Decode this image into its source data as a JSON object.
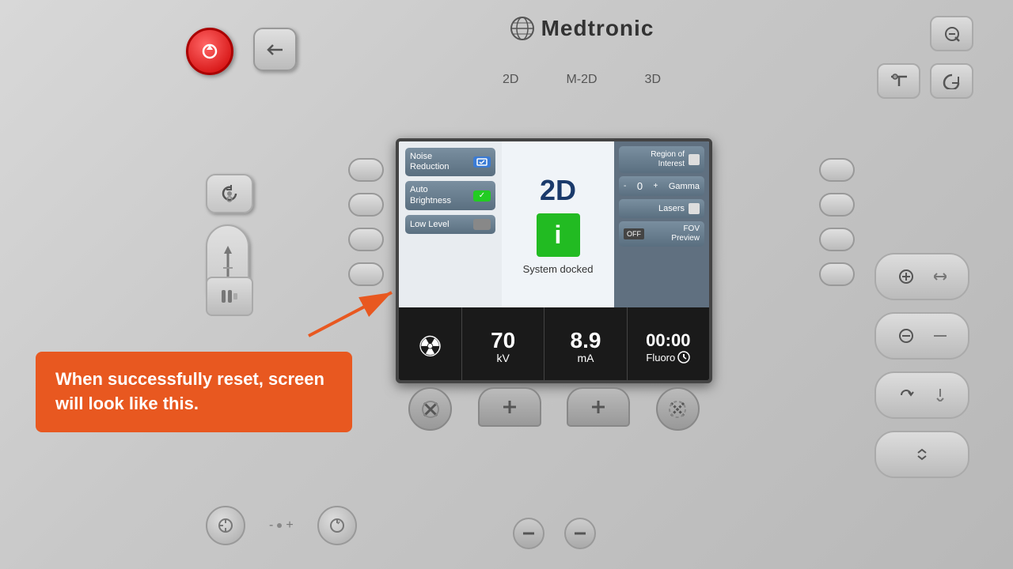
{
  "brand": {
    "name": "Medtronic"
  },
  "mode_tabs": {
    "tab_2d": "2D",
    "tab_m2d": "M-2D",
    "tab_3d": "3D"
  },
  "screen": {
    "mode": "2D",
    "left_options": [
      {
        "label": "Noise Reduction",
        "toggle": "icon",
        "state": "active"
      },
      {
        "label": "Auto Brightness",
        "toggle": "check",
        "state": "active"
      },
      {
        "label": "Low Level",
        "toggle": "gray",
        "state": "inactive"
      }
    ],
    "right_options": [
      {
        "label": "Region of Interest",
        "icon": "box"
      },
      {
        "label": "Gamma",
        "minus": "-",
        "value": "0",
        "plus": "+"
      },
      {
        "label": "Lasers",
        "icon": "square"
      },
      {
        "label": "FOV Preview",
        "off_label": "OFF"
      }
    ],
    "status": "System docked",
    "bottom_bar": {
      "radiation_symbol": "☢",
      "kv_value": "70",
      "kv_unit": "kV",
      "ma_value": "8.9",
      "ma_unit": "mA",
      "fluoro_time": "00:00",
      "fluoro_label": "Fluoro"
    }
  },
  "annotation": {
    "text": "When successfully reset,\nscreen will look like this."
  }
}
